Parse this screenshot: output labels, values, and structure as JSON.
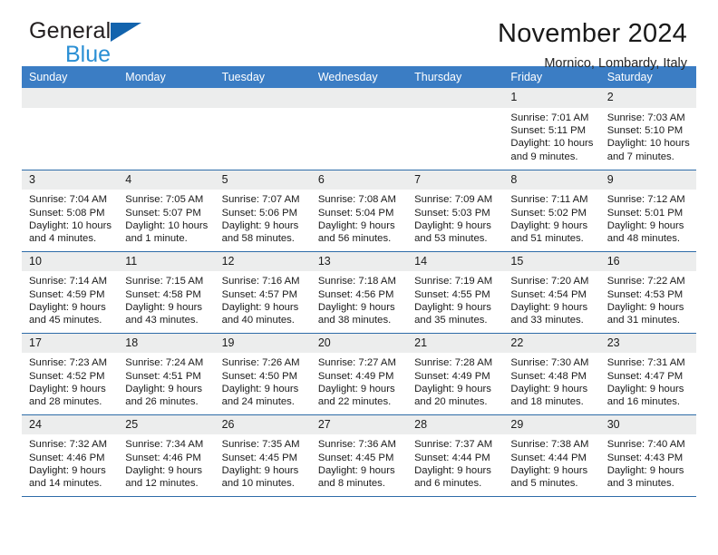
{
  "brand": {
    "line1": "General",
    "line2": "Blue",
    "triangle_color": "#1263ad",
    "blue_text_color": "#2a8fd4"
  },
  "header": {
    "month_title": "November 2024",
    "location": "Mornico, Lombardy, Italy"
  },
  "theme": {
    "header_row_bg": "#3b7dc4",
    "header_row_text": "#ffffff",
    "grid_line": "#2e6ca8",
    "daynum_bg": "#eceded",
    "page_bg": "#ffffff"
  },
  "weekday_headers": [
    "Sunday",
    "Monday",
    "Tuesday",
    "Wednesday",
    "Thursday",
    "Friday",
    "Saturday"
  ],
  "labels": {
    "sunrise_prefix": "Sunrise:",
    "sunset_prefix": "Sunset:",
    "daylight_prefix": "Daylight:"
  },
  "weeks": [
    [
      {
        "empty": true
      },
      {
        "empty": true
      },
      {
        "empty": true
      },
      {
        "empty": true
      },
      {
        "empty": true
      },
      {
        "day": "1",
        "sunrise": "Sunrise: 7:01 AM",
        "sunset": "Sunset: 5:11 PM",
        "daylight": "Daylight: 10 hours and 9 minutes."
      },
      {
        "day": "2",
        "sunrise": "Sunrise: 7:03 AM",
        "sunset": "Sunset: 5:10 PM",
        "daylight": "Daylight: 10 hours and 7 minutes."
      }
    ],
    [
      {
        "day": "3",
        "sunrise": "Sunrise: 7:04 AM",
        "sunset": "Sunset: 5:08 PM",
        "daylight": "Daylight: 10 hours and 4 minutes."
      },
      {
        "day": "4",
        "sunrise": "Sunrise: 7:05 AM",
        "sunset": "Sunset: 5:07 PM",
        "daylight": "Daylight: 10 hours and 1 minute."
      },
      {
        "day": "5",
        "sunrise": "Sunrise: 7:07 AM",
        "sunset": "Sunset: 5:06 PM",
        "daylight": "Daylight: 9 hours and 58 minutes."
      },
      {
        "day": "6",
        "sunrise": "Sunrise: 7:08 AM",
        "sunset": "Sunset: 5:04 PM",
        "daylight": "Daylight: 9 hours and 56 minutes."
      },
      {
        "day": "7",
        "sunrise": "Sunrise: 7:09 AM",
        "sunset": "Sunset: 5:03 PM",
        "daylight": "Daylight: 9 hours and 53 minutes."
      },
      {
        "day": "8",
        "sunrise": "Sunrise: 7:11 AM",
        "sunset": "Sunset: 5:02 PM",
        "daylight": "Daylight: 9 hours and 51 minutes."
      },
      {
        "day": "9",
        "sunrise": "Sunrise: 7:12 AM",
        "sunset": "Sunset: 5:01 PM",
        "daylight": "Daylight: 9 hours and 48 minutes."
      }
    ],
    [
      {
        "day": "10",
        "sunrise": "Sunrise: 7:14 AM",
        "sunset": "Sunset: 4:59 PM",
        "daylight": "Daylight: 9 hours and 45 minutes."
      },
      {
        "day": "11",
        "sunrise": "Sunrise: 7:15 AM",
        "sunset": "Sunset: 4:58 PM",
        "daylight": "Daylight: 9 hours and 43 minutes."
      },
      {
        "day": "12",
        "sunrise": "Sunrise: 7:16 AM",
        "sunset": "Sunset: 4:57 PM",
        "daylight": "Daylight: 9 hours and 40 minutes."
      },
      {
        "day": "13",
        "sunrise": "Sunrise: 7:18 AM",
        "sunset": "Sunset: 4:56 PM",
        "daylight": "Daylight: 9 hours and 38 minutes."
      },
      {
        "day": "14",
        "sunrise": "Sunrise: 7:19 AM",
        "sunset": "Sunset: 4:55 PM",
        "daylight": "Daylight: 9 hours and 35 minutes."
      },
      {
        "day": "15",
        "sunrise": "Sunrise: 7:20 AM",
        "sunset": "Sunset: 4:54 PM",
        "daylight": "Daylight: 9 hours and 33 minutes."
      },
      {
        "day": "16",
        "sunrise": "Sunrise: 7:22 AM",
        "sunset": "Sunset: 4:53 PM",
        "daylight": "Daylight: 9 hours and 31 minutes."
      }
    ],
    [
      {
        "day": "17",
        "sunrise": "Sunrise: 7:23 AM",
        "sunset": "Sunset: 4:52 PM",
        "daylight": "Daylight: 9 hours and 28 minutes."
      },
      {
        "day": "18",
        "sunrise": "Sunrise: 7:24 AM",
        "sunset": "Sunset: 4:51 PM",
        "daylight": "Daylight: 9 hours and 26 minutes."
      },
      {
        "day": "19",
        "sunrise": "Sunrise: 7:26 AM",
        "sunset": "Sunset: 4:50 PM",
        "daylight": "Daylight: 9 hours and 24 minutes."
      },
      {
        "day": "20",
        "sunrise": "Sunrise: 7:27 AM",
        "sunset": "Sunset: 4:49 PM",
        "daylight": "Daylight: 9 hours and 22 minutes."
      },
      {
        "day": "21",
        "sunrise": "Sunrise: 7:28 AM",
        "sunset": "Sunset: 4:49 PM",
        "daylight": "Daylight: 9 hours and 20 minutes."
      },
      {
        "day": "22",
        "sunrise": "Sunrise: 7:30 AM",
        "sunset": "Sunset: 4:48 PM",
        "daylight": "Daylight: 9 hours and 18 minutes."
      },
      {
        "day": "23",
        "sunrise": "Sunrise: 7:31 AM",
        "sunset": "Sunset: 4:47 PM",
        "daylight": "Daylight: 9 hours and 16 minutes."
      }
    ],
    [
      {
        "day": "24",
        "sunrise": "Sunrise: 7:32 AM",
        "sunset": "Sunset: 4:46 PM",
        "daylight": "Daylight: 9 hours and 14 minutes."
      },
      {
        "day": "25",
        "sunrise": "Sunrise: 7:34 AM",
        "sunset": "Sunset: 4:46 PM",
        "daylight": "Daylight: 9 hours and 12 minutes."
      },
      {
        "day": "26",
        "sunrise": "Sunrise: 7:35 AM",
        "sunset": "Sunset: 4:45 PM",
        "daylight": "Daylight: 9 hours and 10 minutes."
      },
      {
        "day": "27",
        "sunrise": "Sunrise: 7:36 AM",
        "sunset": "Sunset: 4:45 PM",
        "daylight": "Daylight: 9 hours and 8 minutes."
      },
      {
        "day": "28",
        "sunrise": "Sunrise: 7:37 AM",
        "sunset": "Sunset: 4:44 PM",
        "daylight": "Daylight: 9 hours and 6 minutes."
      },
      {
        "day": "29",
        "sunrise": "Sunrise: 7:38 AM",
        "sunset": "Sunset: 4:44 PM",
        "daylight": "Daylight: 9 hours and 5 minutes."
      },
      {
        "day": "30",
        "sunrise": "Sunrise: 7:40 AM",
        "sunset": "Sunset: 4:43 PM",
        "daylight": "Daylight: 9 hours and 3 minutes."
      }
    ]
  ]
}
